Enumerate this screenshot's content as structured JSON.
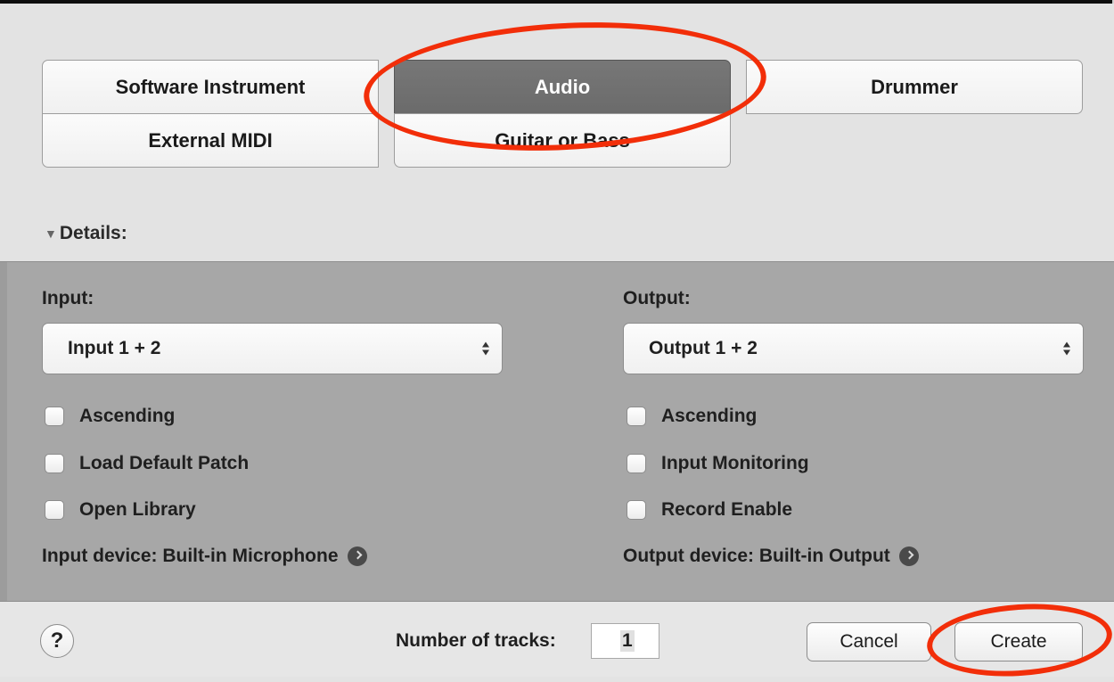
{
  "track_types": {
    "software_instrument": "Software Instrument",
    "audio": "Audio",
    "drummer": "Drummer",
    "external_midi": "External MIDI",
    "guitar_or_bass": "Guitar or Bass",
    "selected": "Audio"
  },
  "details": {
    "toggle_label": "Details:",
    "toggle_icon": "disclosure-triangle-down-icon"
  },
  "input": {
    "label": "Input:",
    "value": "Input 1 + 2",
    "checkboxes": [
      {
        "label": "Ascending",
        "checked": false
      },
      {
        "label": "Load Default Patch",
        "checked": false
      },
      {
        "label": "Open Library",
        "checked": false
      }
    ],
    "device": "Input device: Built-in Microphone"
  },
  "output": {
    "label": "Output:",
    "value": "Output 1 + 2",
    "checkboxes": [
      {
        "label": "Ascending",
        "checked": false
      },
      {
        "label": "Input Monitoring",
        "checked": false
      },
      {
        "label": "Record Enable",
        "checked": false
      }
    ],
    "device": "Output device: Built-in Output"
  },
  "footer": {
    "help_label": "?",
    "tracks_label": "Number of tracks:",
    "tracks_value": "1",
    "cancel_label": "Cancel",
    "create_label": "Create"
  },
  "colors": {
    "annotation": "#f22e09",
    "selected_button": "#6f6f6f",
    "details_panel": "#a7a7a7"
  }
}
